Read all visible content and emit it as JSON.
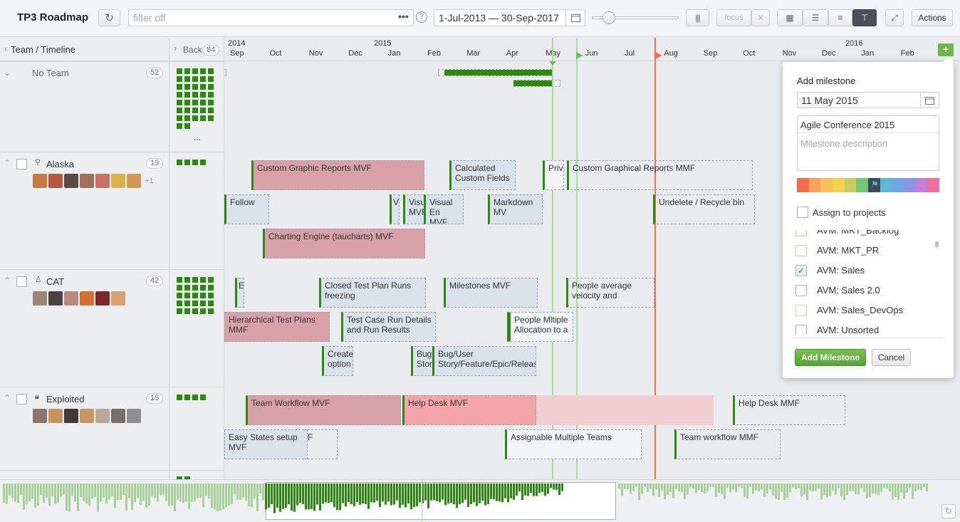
{
  "app_title": "TP3 Roadmap",
  "filter": {
    "placeholder": "filter off",
    "more": "•••",
    "help": "?"
  },
  "date_range": "1-Jul-2013 — 30-Sep-2017",
  "toolbar": {
    "focus": "focus",
    "clear": "✕",
    "actions": "Actions"
  },
  "left_header": "Team / Timeline",
  "mid_header": {
    "label": "Back",
    "count": "84"
  },
  "years": [
    "2014",
    "2015",
    "2016"
  ],
  "months": [
    "Sep",
    "Oct",
    "Nov",
    "Dec",
    "Jan",
    "Feb",
    "Mar",
    "Apr",
    "May",
    "Jun",
    "Jul",
    "Aug",
    "Sep",
    "Oct",
    "Nov",
    "Dec",
    "Jan",
    "Feb"
  ],
  "teams": [
    {
      "name": "No Team",
      "count": "52"
    },
    {
      "name": "Alaska",
      "count": "19",
      "more": "+1"
    },
    {
      "name": "CAT",
      "count": "42"
    },
    {
      "name": "Exploited",
      "count": "15"
    }
  ],
  "no_team_more": "...",
  "cards": {
    "alaska": [
      "Custom Graphic Reports MVF",
      "Calculated Custom Fields",
      "Priv",
      "Custom Graphical Reports MMF",
      "Follow",
      "V",
      "Visu MVF",
      "Visual En MVF",
      "Markdown MV",
      "Undelete / Recycle bin",
      "Charting Engine (taucharts) MVF"
    ],
    "cat": [
      "E",
      "Closed Test Plan Runs freezing",
      "Milestones MVF",
      "People average velocity and",
      "Hierarchical Test Plans MMF",
      "Test Case Run Details and Run Results",
      "People Mltiple Allocation to a",
      "Create option",
      "Bug Stor",
      "Bug/User Story/Feature/Epic/Release"
    ],
    "exploited": [
      "Team Workflow MVF",
      "Help Desk MVF",
      "Help Desk MMF",
      "Easy States setup MVF",
      "F",
      "Assignable Multiple Teams",
      "Team workflow MMF"
    ]
  },
  "popup": {
    "title": "Add milestone",
    "date": "11 May 2015",
    "name": "Agile Conference 2015",
    "desc_placeholder": "Milestone description",
    "assign_label": "Assign to projects",
    "projects": [
      "AVM: MKT_Backlog",
      "AVM: MKT_PR",
      "AVM: Sales",
      "AVM: Sales 2.0",
      "AVM: Sales_DevOps",
      "AVM: Unsorted"
    ],
    "checked_project": "AVM: Sales",
    "add_button": "Add Milestone",
    "cancel_button": "Cancel",
    "palette": [
      "#f36b4b",
      "#f6a35c",
      "#f7c05a",
      "#f2d14e",
      "#c6cd5a",
      "#74c576",
      "#3b4a56",
      "#5bb8d5",
      "#6fa6e3",
      "#8d94e5",
      "#c27fd8",
      "#f26d9c"
    ]
  },
  "colors": {
    "green": "#2a8a10",
    "milestone_green": "#8fd07a",
    "milestone_red": "#f07055"
  }
}
